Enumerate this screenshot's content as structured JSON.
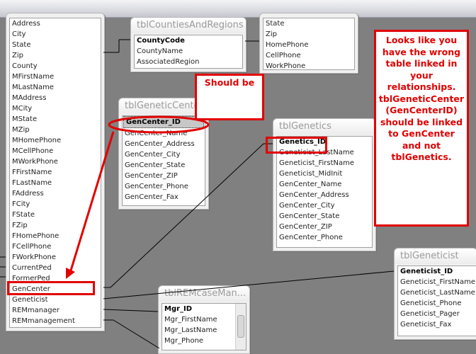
{
  "tables": {
    "main": {
      "fields": [
        "Address",
        "City",
        "State",
        "Zip",
        "County",
        "MFirstName",
        "MLastName",
        "MAddress",
        "MCity",
        "MState",
        "MZip",
        "MHomePhone",
        "MCellPhone",
        "MWorkPhone",
        "FFirstName",
        "FLastName",
        "FAddress",
        "FCity",
        "FState",
        "FZip",
        "FHomePhone",
        "FCellPhone",
        "FWorkPhone",
        "CurrentPed",
        "FormerPed",
        "GenCenter",
        "Geneticist",
        "REMmanager",
        "REMmanagement"
      ]
    },
    "counties": {
      "title": "tblCountiesAndRegions",
      "fields": [
        "CountyCode",
        "CountyName",
        "AssociatedRegion"
      ]
    },
    "contact": {
      "fields": [
        "State",
        "Zip",
        "HomePhone",
        "CellPhone",
        "WorkPhone"
      ]
    },
    "geneticCenter": {
      "title": "tblGeneticCenter",
      "fields": [
        "GenCenter_ID",
        "GenCenter_Name",
        "GenCenter_Address",
        "GenCenter_City",
        "GenCenter_State",
        "GenCenter_ZIP",
        "GenCenter_Phone",
        "GenCenter_Fax"
      ]
    },
    "genetics": {
      "title": "tblGenetics",
      "fields": [
        "Genetics_ID",
        "Geneticist_LastName",
        "Geneticist_FirstName",
        "Geneticist_MidInit",
        "GenCenter_Name",
        "GenCenter_Address",
        "GenCenter_City",
        "GenCenter_State",
        "GenCenter_ZIP",
        "GenCenter_Phone"
      ]
    },
    "geneticist": {
      "title": "tblGeneticist",
      "fields": [
        "Geneticist_ID",
        "Geneticist_FirstName",
        "Geneticist_LastName",
        "Geneticist_Phone",
        "Geneticist_Pager",
        "Geneticist_Fax"
      ]
    },
    "remcase": {
      "title": "tblREMcaseMan...",
      "fields": [
        "Mgr_ID",
        "Mgr_FirstName",
        "Mgr_LastName",
        "Mgr_Phone"
      ]
    }
  },
  "annotations": {
    "should_be": "Should be",
    "explanation": "Looks like you have the wrong table linked in your relationships. tblGeneticCenter (GenCenterID) should be linked to GenCenter and not tblGenetics."
  },
  "colors": {
    "annotation_red": "#e20000",
    "canvas": "#808080"
  }
}
